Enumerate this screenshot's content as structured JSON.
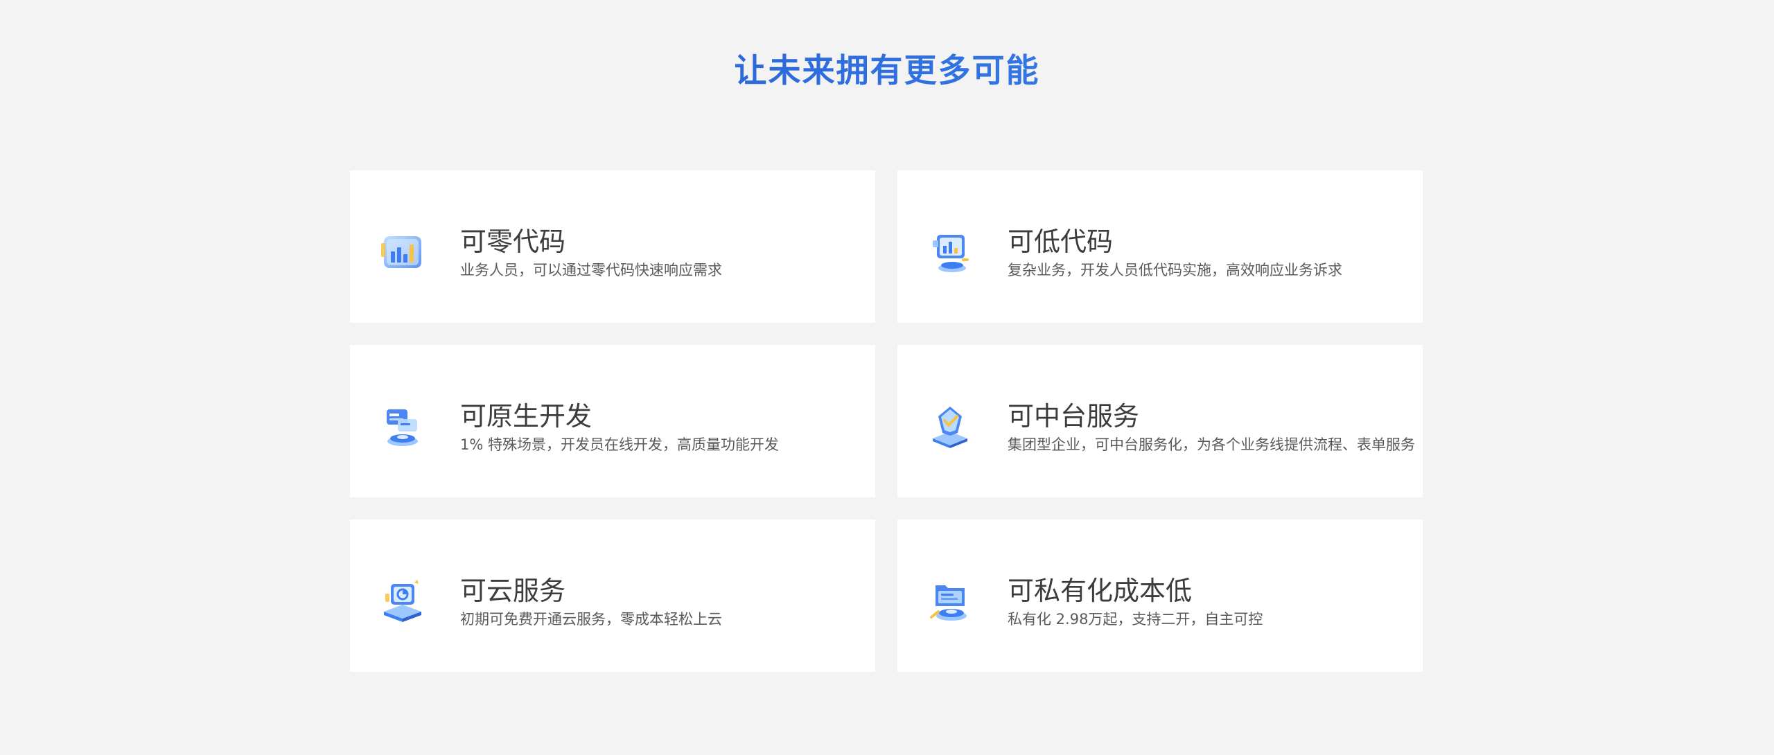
{
  "heading": "让未来拥有更多可能",
  "cards": [
    {
      "title": "可零代码",
      "desc": "业务人员，可以通过零代码快速响应需求",
      "icon": "bar-chart-icon"
    },
    {
      "title": "可低代码",
      "desc": "复杂业务，开发人员低代码实施，高效响应业务诉求",
      "icon": "dashboard-monitor-icon"
    },
    {
      "title": "可原生开发",
      "desc": "1% 特殊场景，开发员在线开发，高质量功能开发",
      "icon": "code-stack-icon"
    },
    {
      "title": "可中台服务",
      "desc": "集团型企业，可中台服务化，为各个业务线提供流程、表单服务",
      "icon": "shield-check-icon"
    },
    {
      "title": "可云服务",
      "desc": "初期可免费开通云服务，零成本轻松上云",
      "icon": "cloud-screen-icon"
    },
    {
      "title": "可私有化成本低",
      "desc": "私有化 2.98万起，支持二开，自主可控",
      "icon": "folder-stack-icon"
    }
  ],
  "colors": {
    "background": "#f3f3f3",
    "heading_gradient_start": "#1f4fb8",
    "heading_gradient_end": "#4a94ef",
    "card_background": "#ffffff",
    "icon_blue": "#3f7ef0",
    "icon_light_blue": "#9cc8ff",
    "icon_accent_yellow": "#f6c342"
  }
}
